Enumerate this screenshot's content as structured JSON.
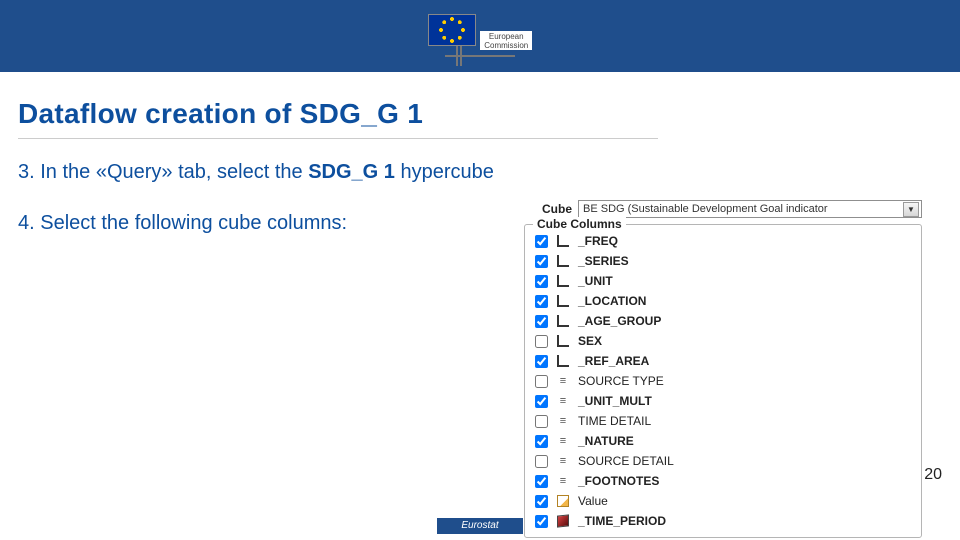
{
  "header": {
    "logo_caption_line1": "European",
    "logo_caption_line2": "Commission"
  },
  "title": "Dataflow creation of SDG_G 1",
  "steps": {
    "s3_prefix": "3. In the «Query» tab, select the ",
    "s3_bold": "SDG_G 1",
    "s3_suffix": " hypercube",
    "s4": "4. Select the following cube columns:"
  },
  "cube": {
    "label": "Cube",
    "selected": "BE  SDG (Sustainable Development Goal indicator",
    "columns_legend": "Cube Columns",
    "columns": [
      {
        "checked": true,
        "icon": "L",
        "bold": true,
        "label": "_FREQ"
      },
      {
        "checked": true,
        "icon": "L",
        "bold": true,
        "label": "_SERIES"
      },
      {
        "checked": true,
        "icon": "L",
        "bold": true,
        "label": "_UNIT"
      },
      {
        "checked": true,
        "icon": "L",
        "bold": true,
        "label": "_LOCATION"
      },
      {
        "checked": true,
        "icon": "L",
        "bold": true,
        "label": "_AGE_GROUP"
      },
      {
        "checked": false,
        "icon": "L",
        "bold": true,
        "label": "SEX"
      },
      {
        "checked": true,
        "icon": "L",
        "bold": true,
        "label": "_REF_AREA"
      },
      {
        "checked": false,
        "icon": "eq",
        "bold": false,
        "label": "SOURCE TYPE"
      },
      {
        "checked": true,
        "icon": "eq",
        "bold": true,
        "label": "_UNIT_MULT"
      },
      {
        "checked": false,
        "icon": "eq",
        "bold": false,
        "label": "TIME  DETAIL"
      },
      {
        "checked": true,
        "icon": "eq",
        "bold": true,
        "label": "_NATURE"
      },
      {
        "checked": false,
        "icon": "eq",
        "bold": false,
        "label": "SOURCE  DETAIL"
      },
      {
        "checked": true,
        "icon": "eq",
        "bold": true,
        "label": "_FOOTNOTES"
      },
      {
        "checked": true,
        "icon": "note",
        "bold": false,
        "label": "Value"
      },
      {
        "checked": true,
        "icon": "cube",
        "bold": true,
        "label": "_TIME_PERIOD"
      }
    ]
  },
  "page_number": "20",
  "footer": "Eurostat"
}
